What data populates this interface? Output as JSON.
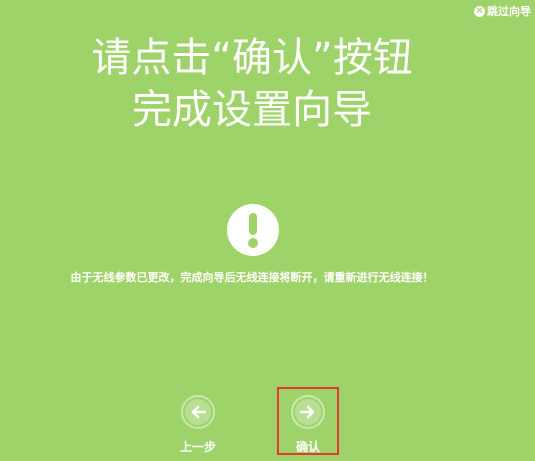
{
  "skip": {
    "label": "跳过向导",
    "icon": "close-circle-icon"
  },
  "headline": {
    "line1": "请点击“确认”按钮",
    "line2": "完成设置向导"
  },
  "alert": {
    "icon": "exclamation-icon"
  },
  "message": {
    "text": "由于无线参数已更改，完成向导后无线连接将断开，请重新进行无线连接！"
  },
  "navigation": {
    "previous_label": "上一步",
    "previous_icon": "arrow-left-icon",
    "confirm_label": "确认",
    "confirm_icon": "arrow-right-icon"
  },
  "colors": {
    "background": "#9ed36a",
    "text": "#ffffff",
    "highlight": "#e23b2e"
  }
}
